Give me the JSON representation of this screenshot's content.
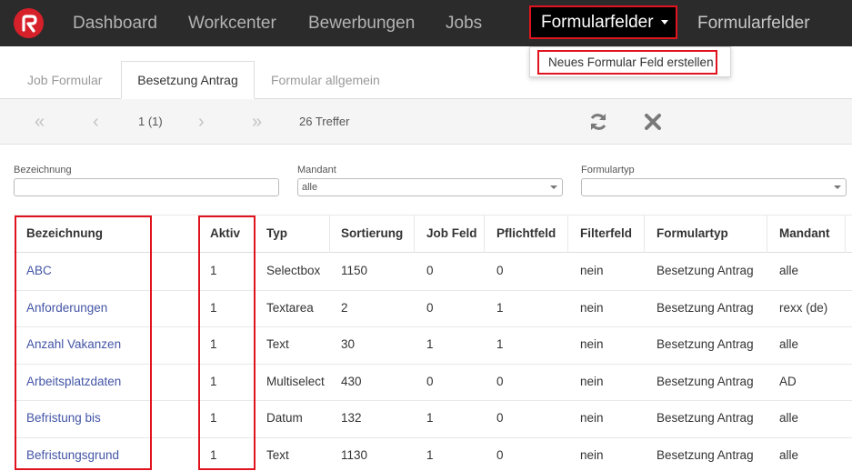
{
  "nav": {
    "items": [
      "Dashboard",
      "Workcenter",
      "Bewerbungen",
      "Jobs"
    ],
    "active": "Formularfelder",
    "right_title": "Formularfelder"
  },
  "dropdown": {
    "item": "Neues Formular Feld erstellen"
  },
  "tabs": [
    "Job Formular",
    "Besetzung Antrag",
    "Formular allgemein"
  ],
  "pager": {
    "page": "1 (1)",
    "hits": "26 Treffer"
  },
  "filters": {
    "bezeichnung_label": "Bezeichnung",
    "bezeichnung_value": "",
    "mandant_label": "Mandant",
    "mandant_value": "alle",
    "formulartyp_label": "Formulartyp",
    "formulartyp_value": ""
  },
  "table": {
    "headers": [
      "Bezeichnung",
      "Aktiv",
      "Typ",
      "Sortierung",
      "Job Feld",
      "Pflichtfeld",
      "Filterfeld",
      "Formulartyp",
      "Mandant"
    ],
    "rows": [
      [
        "ABC",
        "1",
        "Selectbox",
        "1150",
        "0",
        "0",
        "nein",
        "Besetzung Antrag",
        "alle"
      ],
      [
        "Anforderungen",
        "1",
        "Textarea",
        "2",
        "0",
        "1",
        "nein",
        "Besetzung Antrag",
        "rexx (de)"
      ],
      [
        "Anzahl Vakanzen",
        "1",
        "Text",
        "30",
        "1",
        "1",
        "nein",
        "Besetzung Antrag",
        "alle"
      ],
      [
        "Arbeitsplatzdaten",
        "1",
        "Multiselect",
        "430",
        "0",
        "0",
        "nein",
        "Besetzung Antrag",
        "AD"
      ],
      [
        "Befristung bis",
        "1",
        "Datum",
        "132",
        "1",
        "0",
        "nein",
        "Besetzung Antrag",
        "alle"
      ],
      [
        "Befristungsgrund",
        "1",
        "Text",
        "1130",
        "1",
        "0",
        "nein",
        "Besetzung Antrag",
        "alle"
      ]
    ]
  },
  "colors": {
    "nav_bg": "#2b2b2b",
    "highlight": "#e0141e",
    "link": "#4355a6",
    "logo": "#d6202a"
  }
}
